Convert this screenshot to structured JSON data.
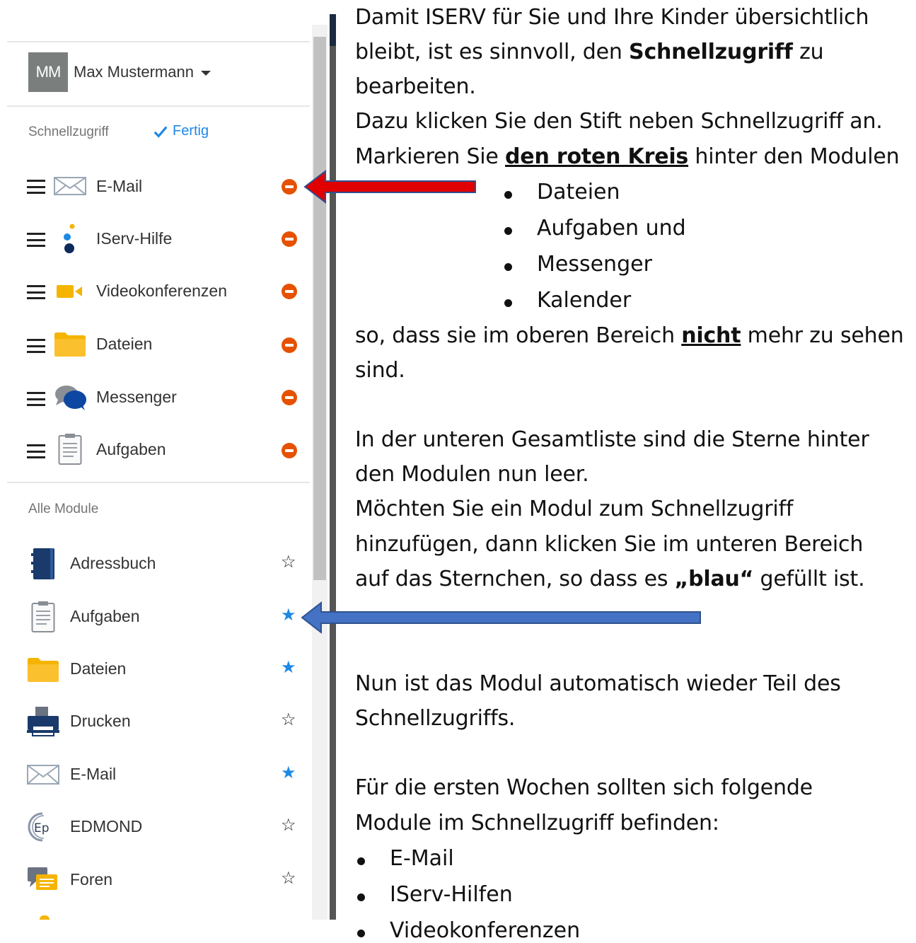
{
  "sidebar": {
    "user": {
      "initials": "MM",
      "name": "Max Mustermann"
    },
    "quick_access": {
      "title": "Schnellzugriff",
      "done_label": "Fertig",
      "items": [
        {
          "label": "E-Mail",
          "icon": "mail-icon"
        },
        {
          "label": "IServ-Hilfe",
          "icon": "help-dots-icon"
        },
        {
          "label": "Videokonferenzen",
          "icon": "video-camera-icon"
        },
        {
          "label": "Dateien",
          "icon": "folder-icon"
        },
        {
          "label": "Messenger",
          "icon": "chat-bubbles-icon"
        },
        {
          "label": "Aufgaben",
          "icon": "clipboard-icon"
        }
      ]
    },
    "all_modules": {
      "title": "Alle Module",
      "items": [
        {
          "label": "Adressbuch",
          "icon": "address-book-icon",
          "starred": false
        },
        {
          "label": "Aufgaben",
          "icon": "clipboard-icon",
          "starred": true
        },
        {
          "label": "Dateien",
          "icon": "folder-icon",
          "starred": true
        },
        {
          "label": "Drucken",
          "icon": "printer-icon",
          "starred": false
        },
        {
          "label": "E-Mail",
          "icon": "mail-icon",
          "starred": true
        },
        {
          "label": "EDMOND",
          "icon": "edmond-icon",
          "starred": false
        },
        {
          "label": "Foren",
          "icon": "forum-icon",
          "starred": false
        }
      ]
    }
  },
  "instructions": {
    "p1_line1": "Damit ISERV für Sie und Ihre Kinder übersichtlich",
    "p1_line2_a": "bleibt, ist es sinnvoll, den ",
    "p1_line2_b": "Schnellzugriff",
    "p1_line2_c": " zu",
    "p1_line3": "bearbeiten.",
    "p2_line1": "Dazu klicken Sie den Stift neben Schnellzugriff an.",
    "p2_line2_a": "Markieren Sie ",
    "p2_line2_b": "den roten Kreis",
    "p2_line2_c": " hinter den  Modulen",
    "remove_list": [
      "Dateien",
      "Aufgaben und",
      "Messenger",
      "Kalender"
    ],
    "p3_line1_a": "so, dass sie im oberen Bereich ",
    "p3_line1_b": "nicht",
    "p3_line1_c": " mehr zu sehen",
    "p3_line2": "sind.",
    "p4_line1": "In der unteren Gesamtliste sind die Sterne hinter",
    "p4_line2": "den Modulen nun leer.",
    "p5_line1": "Möchten Sie ein Modul zum Schnellzugriff",
    "p5_line2": "hinzufügen, dann klicken Sie im unteren Bereich",
    "p5_line3_a": "auf das Sternchen, so dass es ",
    "p5_line3_b": "„blau“",
    "p5_line3_c": " gefüllt ist.",
    "p6_line1": "Nun ist das Modul automatisch wieder Teil des",
    "p6_line2": "Schnellzugriffs.",
    "p7_line1": "Für die ersten Wochen sollten sich folgende",
    "p7_line2": "Module im Schnellzugriff befinden:",
    "keep_list": [
      "E-Mail",
      "IServ-Hilfen",
      "Videokonferenzen"
    ]
  },
  "colors": {
    "accent_blue": "#1e88e5",
    "remove_orange": "#e65100",
    "arrow_red": "#e00000",
    "arrow_blue": "#4472c4"
  }
}
